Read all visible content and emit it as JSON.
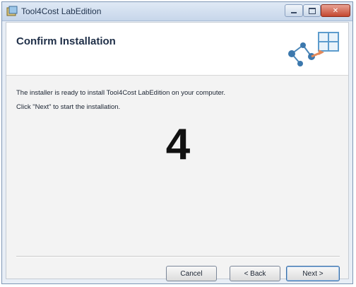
{
  "window": {
    "title": "Tool4Cost LabEdition"
  },
  "header": {
    "title": "Confirm Installation",
    "graphic_icon": "network-install-icon"
  },
  "body": {
    "line1": "The installer is ready to install Tool4Cost LabEdition on your computer.",
    "line2": "Click \"Next\" to start the installation.",
    "step_number": "4"
  },
  "buttons": {
    "cancel": "Cancel",
    "back": "< Back",
    "next": "Next >"
  },
  "colors": {
    "accent": "#3a6ea5",
    "close": "#c4472f"
  }
}
